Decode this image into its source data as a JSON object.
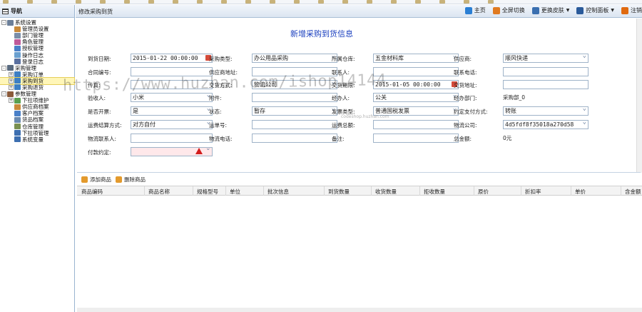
{
  "colors": {
    "accent": "#1a3fbf",
    "header_bg": "#dbe5f1",
    "selected_row": "#fff6b8",
    "required_bg": "#ffe8ea",
    "warning": "#d21c1c"
  },
  "sidebar": {
    "title": "导航",
    "tree": [
      {
        "label": "系统设置",
        "level": 0,
        "toggle": "-",
        "icon": "gear-icon",
        "color": "#6b7f99"
      },
      {
        "label": "管理员设置",
        "level": 1,
        "icon": "user-icon",
        "color": "#c98a3a"
      },
      {
        "label": "部门管理",
        "level": 1,
        "icon": "dept-icon",
        "color": "#7a8ea8"
      },
      {
        "label": "角色管理",
        "level": 1,
        "icon": "role-icon",
        "color": "#c05a9a"
      },
      {
        "label": "授权管理",
        "level": 1,
        "icon": "auth-icon",
        "color": "#4a80c8"
      },
      {
        "label": "操作日志",
        "level": 1,
        "icon": "log-icon",
        "color": "#6aa0d0"
      },
      {
        "label": "登录日志",
        "level": 1,
        "icon": "login-log-icon",
        "color": "#5a70a0"
      },
      {
        "label": "采购管理",
        "level": 0,
        "toggle": "-",
        "icon": "purchase-icon",
        "color": "#5a6b80"
      },
      {
        "label": "采购订单",
        "level": 1,
        "toggle": "+",
        "icon": "order-icon",
        "color": "#3d7fc4"
      },
      {
        "label": "采购到货",
        "level": 1,
        "toggle": "+",
        "icon": "arrival-icon",
        "color": "#3d7fc4",
        "selected": true
      },
      {
        "label": "采购退货",
        "level": 1,
        "toggle": "+",
        "icon": "return-icon",
        "color": "#3d7fc4"
      },
      {
        "label": "参数管理",
        "level": 0,
        "toggle": "-",
        "icon": "params-icon",
        "color": "#8a5a3a"
      },
      {
        "label": "下拉项维护",
        "level": 1,
        "toggle": "+",
        "icon": "dropdown-icon",
        "color": "#5aa050"
      },
      {
        "label": "供应商档案",
        "level": 1,
        "icon": "supplier-icon",
        "color": "#c98a3a"
      },
      {
        "label": "客户档案",
        "level": 1,
        "icon": "customer-icon",
        "color": "#4a80c8"
      },
      {
        "label": "货品档案",
        "level": 1,
        "icon": "goods-icon",
        "color": "#6a8ab0"
      },
      {
        "label": "仓库管理",
        "level": 1,
        "icon": "warehouse-icon",
        "color": "#7a9050"
      },
      {
        "label": "下拉项管理",
        "level": 1,
        "icon": "dropdown-manage-icon",
        "color": "#3d6fb0"
      },
      {
        "label": "系统变量",
        "level": 1,
        "icon": "variable-icon",
        "color": "#3d6fb0"
      }
    ]
  },
  "header": {
    "title": "修改采购到货",
    "actions": [
      {
        "label": "主页",
        "icon": "home-icon",
        "color": "#2a7fd4"
      },
      {
        "label": "全屏切换",
        "icon": "fullscreen-icon",
        "color": "#e07a20"
      },
      {
        "label": "更换皮肤",
        "icon": "skin-icon",
        "color": "#3a6fb0",
        "dropdown": true
      },
      {
        "label": "控制面板",
        "icon": "control-panel-icon",
        "color": "#2a5a9a",
        "dropdown": true
      },
      {
        "label": "注销",
        "icon": "logout-icon",
        "color": "#e06a10"
      }
    ]
  },
  "form": {
    "title": "新增采购到货信息",
    "fields": {
      "arrival_date": {
        "label": "到货日期:",
        "value": "2015-01-22 00:00:00"
      },
      "purchase_type": {
        "label": "采购类型:",
        "value": "办公用品采购"
      },
      "warehouse": {
        "label": "所属仓库:",
        "value": "五金材料库"
      },
      "supplier": {
        "label": "供应商:",
        "value": "顺风快递"
      },
      "contract_no": {
        "label": "合同编号:",
        "value": ""
      },
      "supplier_address": {
        "label": "供应商地址:",
        "value": ""
      },
      "contact": {
        "label": "联系人:",
        "value": ""
      },
      "contact_phone": {
        "label": "联系电话:",
        "value": ""
      },
      "fax": {
        "label": "传真:",
        "value": ""
      },
      "delivery_method": {
        "label": "交货方式:",
        "value": "物流公司"
      },
      "delivery_deadline": {
        "label": "交货期限:",
        "value": "2015-01-05 00:00:00"
      },
      "delivery_address": {
        "label": "交货地址:",
        "value": ""
      },
      "receiver": {
        "label": "验收人:",
        "value": "小米"
      },
      "attachment": {
        "label": "附件:",
        "value": ""
      },
      "handler": {
        "label": "经办人:",
        "value": "公关"
      },
      "handler_dept": {
        "label": "经办部门:",
        "value": "采购部_0"
      },
      "is_invoiced": {
        "label": "是否开票:",
        "value": "是"
      },
      "status": {
        "label": "状态:",
        "value": "暂存"
      },
      "invoice_type": {
        "label": "发票类型:",
        "value": "普通国税发票"
      },
      "payment_method": {
        "label": "约定支付方式:",
        "value": "转账"
      },
      "freight_settlement": {
        "label": "运费结算方式:",
        "value": "对方自付"
      },
      "waybill_no": {
        "label": "运单号:",
        "value": ""
      },
      "freight_total": {
        "label": "运费总额:",
        "value": ""
      },
      "logistics_company": {
        "label": "物流公司:",
        "value": "4d5fdf8f35018a270d58"
      },
      "logistics_contact": {
        "label": "物流联系人:",
        "value": ""
      },
      "logistics_phone": {
        "label": "物流电话:",
        "value": ""
      },
      "remarks": {
        "label": "备注:",
        "value": ""
      },
      "total_amount": {
        "label": "总金额:",
        "value": "0元"
      },
      "payment_agreement": {
        "label": "付款约定:",
        "value": ""
      }
    }
  },
  "grid": {
    "add_label": "添加商品",
    "delete_label": "删除商品",
    "columns": [
      "商品编码",
      "商品名称",
      "规格型号",
      "单位",
      "批次信息",
      "到货数量",
      "收货数量",
      "拒收数量",
      "原价",
      "折扣率",
      "单价",
      "含金额"
    ]
  },
  "watermark": {
    "main": "https://www.huzhan.com/ishop14144",
    "small": "codeshop.huzhan.com"
  }
}
